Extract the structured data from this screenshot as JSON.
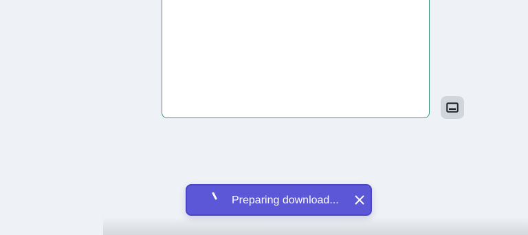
{
  "toast": {
    "message": "Preparing download...",
    "spinner_icon": "loading-spinner-icon",
    "close_icon": "close-icon",
    "background_color": "#5b57d6"
  },
  "side_button": {
    "icon": "subtitles-icon",
    "background_color": "#d1d6dd"
  },
  "editor": {
    "border_color": "#3e9a7c"
  }
}
